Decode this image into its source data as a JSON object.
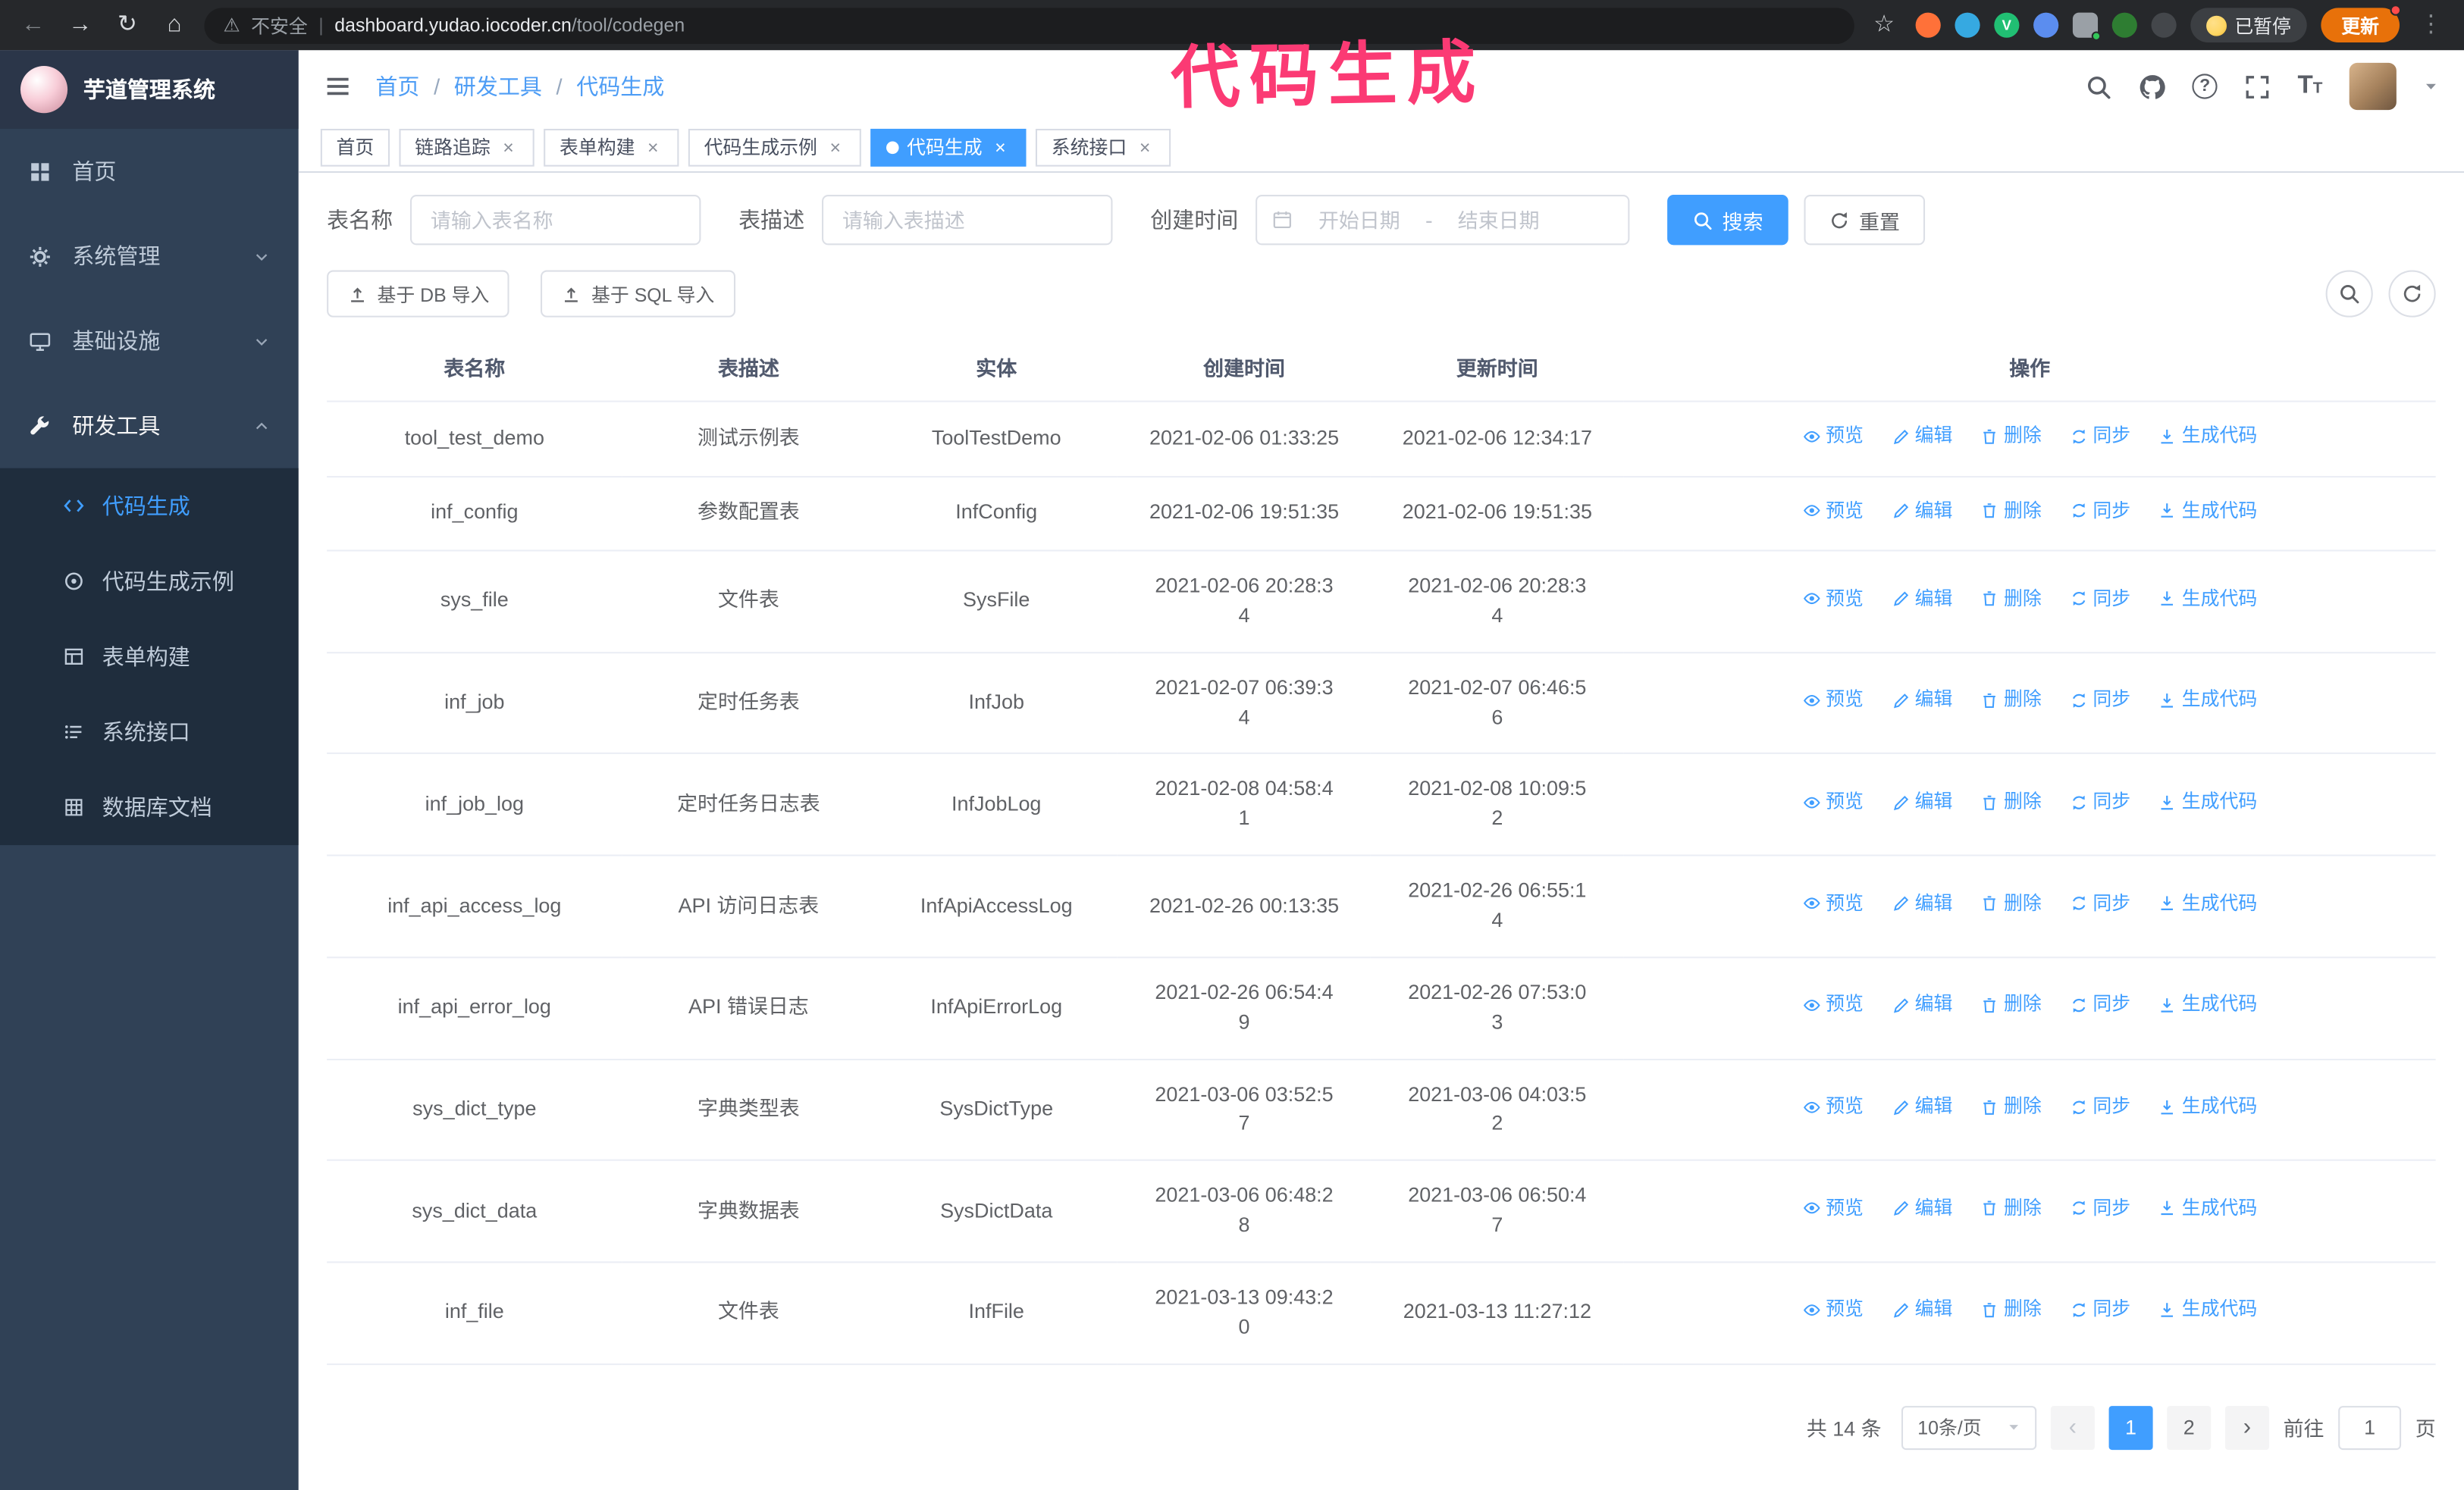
{
  "browser": {
    "security_label": "不安全",
    "url_host": "dashboard.yudao.iocoder.cn",
    "url_path": "/tool/codegen",
    "paused_badge": "已暂停",
    "update_button": "更新"
  },
  "annotation": {
    "text": "代码生成",
    "color": "#fb3a74"
  },
  "sidebar": {
    "logo_title": "芋道管理系统",
    "items": [
      {
        "label": "首页"
      },
      {
        "label": "系统管理"
      },
      {
        "label": "基础设施"
      },
      {
        "label": "研发工具"
      }
    ],
    "submenu": [
      {
        "label": "代码生成",
        "active": true
      },
      {
        "label": "代码生成示例"
      },
      {
        "label": "表单构建"
      },
      {
        "label": "系统接口"
      },
      {
        "label": "数据库文档"
      }
    ]
  },
  "header": {
    "breadcrumb": [
      "首页",
      "研发工具",
      "代码生成"
    ]
  },
  "tabs": [
    {
      "label": "首页"
    },
    {
      "label": "链路追踪"
    },
    {
      "label": "表单构建"
    },
    {
      "label": "代码生成示例"
    },
    {
      "label": "代码生成",
      "active": true
    },
    {
      "label": "系统接口"
    }
  ],
  "filters": {
    "table_name_label": "表名称",
    "table_name_placeholder": "请输入表名称",
    "table_desc_label": "表描述",
    "table_desc_placeholder": "请输入表描述",
    "create_time_label": "创建时间",
    "date_start_placeholder": "开始日期",
    "date_separator": "-",
    "date_end_placeholder": "结束日期",
    "search_button": "搜索",
    "reset_button": "重置"
  },
  "toolbar": {
    "import_db_button": "基于 DB 导入",
    "import_sql_button": "基于 SQL 导入"
  },
  "table": {
    "columns": [
      "表名称",
      "表描述",
      "实体",
      "创建时间",
      "更新时间",
      "操作"
    ],
    "actions": [
      "预览",
      "编辑",
      "删除",
      "同步",
      "生成代码"
    ],
    "rows": [
      {
        "name": "tool_test_demo",
        "desc": "测试示例表",
        "entity": "ToolTestDemo",
        "created": "2021-02-06 01:33:25",
        "updated": "2021-02-06 12:34:17"
      },
      {
        "name": "inf_config",
        "desc": "参数配置表",
        "entity": "InfConfig",
        "created": "2021-02-06 19:51:35",
        "updated": "2021-02-06 19:51:35"
      },
      {
        "name": "sys_file",
        "desc": "文件表",
        "entity": "SysFile",
        "created": "2021-02-06 20:28:3\n4",
        "updated": "2021-02-06 20:28:3\n4"
      },
      {
        "name": "inf_job",
        "desc": "定时任务表",
        "entity": "InfJob",
        "created": "2021-02-07 06:39:3\n4",
        "updated": "2021-02-07 06:46:5\n6"
      },
      {
        "name": "inf_job_log",
        "desc": "定时任务日志表",
        "entity": "InfJobLog",
        "created": "2021-02-08 04:58:4\n1",
        "updated": "2021-02-08 10:09:5\n2"
      },
      {
        "name": "inf_api_access_log",
        "desc": "API 访问日志表",
        "entity": "InfApiAccessLog",
        "created": "2021-02-26 00:13:35",
        "updated": "2021-02-26 06:55:1\n4"
      },
      {
        "name": "inf_api_error_log",
        "desc": "API 错误日志",
        "entity": "InfApiErrorLog",
        "created": "2021-02-26 06:54:4\n9",
        "updated": "2021-02-26 07:53:0\n3"
      },
      {
        "name": "sys_dict_type",
        "desc": "字典类型表",
        "entity": "SysDictType",
        "created": "2021-03-06 03:52:5\n7",
        "updated": "2021-03-06 04:03:5\n2"
      },
      {
        "name": "sys_dict_data",
        "desc": "字典数据表",
        "entity": "SysDictData",
        "created": "2021-03-06 06:48:2\n8",
        "updated": "2021-03-06 06:50:4\n7"
      },
      {
        "name": "inf_file",
        "desc": "文件表",
        "entity": "InfFile",
        "created": "2021-03-13 09:43:2\n0",
        "updated": "2021-03-13 11:27:12"
      }
    ]
  },
  "pagination": {
    "total": "共 14 条",
    "page_size": "10条/页",
    "pages": [
      "1",
      "2"
    ],
    "active_page": "1",
    "goto_label": "前往",
    "goto_value": "1",
    "goto_unit": "页"
  },
  "colors": {
    "accent": "#409eff",
    "sidebar_bg": "#304156",
    "submenu_bg": "#1f2d3d",
    "chrome_bg": "#26282b",
    "annotation": "#fb3a74",
    "update_button_bg": "#e8710a"
  }
}
